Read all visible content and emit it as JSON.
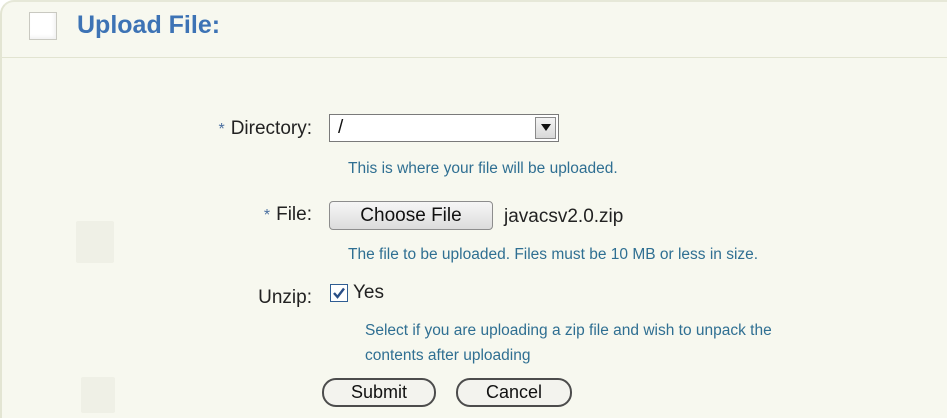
{
  "header": {
    "title": "Upload File:"
  },
  "form": {
    "directory": {
      "required_mark": "*",
      "label": "Directory:",
      "selected_value": "/",
      "hint": "This is where your file will be uploaded."
    },
    "file": {
      "required_mark": "*",
      "label": "File:",
      "button_label": "Choose File",
      "file_name": "javacsv2.0.zip",
      "hint": "The file to be uploaded. Files must be 10 MB or less in size."
    },
    "unzip": {
      "label": "Unzip:",
      "checked": true,
      "option_label": "Yes",
      "hint_line1": "Select if you are uploading a zip file and wish to unpack the",
      "hint_line2": "contents after uploading"
    },
    "actions": {
      "submit_label": "Submit",
      "cancel_label": "Cancel"
    }
  },
  "colors": {
    "title": "#3d73b5",
    "hint": "#2f6f92",
    "panel_background": "#f7f8ef",
    "required_mark": "#4a6fa0"
  },
  "icons": {
    "header_box": "collapse-box-icon",
    "select_arrow": "chevron-down-icon",
    "checkbox_mark": "checkmark-icon"
  }
}
